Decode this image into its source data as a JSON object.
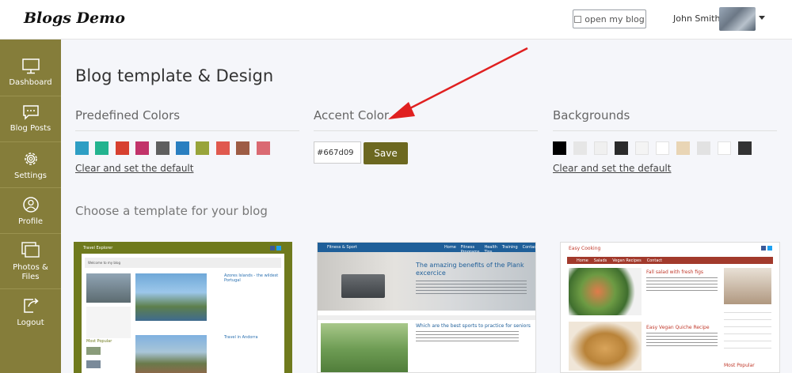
{
  "header": {
    "logo": "Blogs Demo",
    "open_blog_label": "open my blog",
    "user_name": "John Smith"
  },
  "sidebar": {
    "items": [
      {
        "label": "Dashboard",
        "icon": "monitor-icon"
      },
      {
        "label": "Blog Posts",
        "icon": "speech-bubble-icon"
      },
      {
        "label": "Settings",
        "icon": "gear-icon"
      },
      {
        "label": "Profile",
        "icon": "user-icon"
      },
      {
        "label": "Photos & Files",
        "icon": "images-icon"
      },
      {
        "label": "Logout",
        "icon": "logout-icon"
      }
    ]
  },
  "main": {
    "title": "Blog template & Design",
    "predefined": {
      "title": "Predefined Colors",
      "colors": [
        "#2e9ec4",
        "#23b38f",
        "#d7402f",
        "#c2336a",
        "#5f5f5f",
        "#2a7fc0",
        "#98a43a",
        "#e0594e",
        "#9d5c44",
        "#da6a72"
      ],
      "reset_label": "Clear and set the default"
    },
    "accent": {
      "title": "Accent Color",
      "value": "#667d09",
      "save_label": "Save"
    },
    "backgrounds": {
      "title": "Backgrounds",
      "swatches": [
        "#000000",
        "#e6e6e6",
        "#f0f0f0",
        "#2b2b2b",
        "#f4f4f4",
        "#ffffff",
        "#e9d5b5",
        "#e2e2e2",
        "#ffffff",
        "#333333"
      ],
      "reset_label": "Clear and set the default"
    },
    "choose_title": "Choose a template for your blog"
  },
  "templates": [
    {
      "name": "Travel Explorer",
      "headline1": "Azores Islands - the wildest Portugal",
      "headline2": "Travel in Andorra",
      "sidebar_heading": "Most Popular",
      "welcome": "Welcome to my blog"
    },
    {
      "name": "Fitness & Sport",
      "nav": [
        "Home",
        "Fitness Programs",
        "Health Tips",
        "Training",
        "Contact"
      ],
      "headline1": "The amazing benefits of the Plank excercice",
      "headline2": "Which are the best sports to practice for seniors"
    },
    {
      "name": "Easy Cooking",
      "nav": [
        "Home",
        "Salads",
        "Vegan Recipes",
        "Contact"
      ],
      "headline1": "Fall salad with fresh figs",
      "headline2": "Easy Vegan Quiche Recipe",
      "sidebar_heading": "Most Popular"
    }
  ],
  "colors": {
    "sidebar": "#857d3a",
    "save_button": "#6c6820",
    "arrow": "#e02020"
  }
}
